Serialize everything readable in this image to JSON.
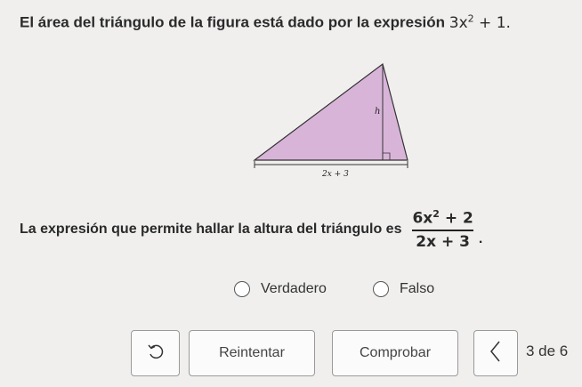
{
  "question": {
    "text": "El área del triángulo de la figura está dado por la expresión",
    "expr_base": "3x",
    "expr_exp": "2",
    "expr_tail": " + 1."
  },
  "figure": {
    "height_label": "h",
    "base_label": "2x + 3",
    "fill_color": "#d9b4d9",
    "stroke_color": "#333333"
  },
  "statement": {
    "text": "La expresión que permite hallar la altura del triángulo es",
    "num_base": "6x",
    "num_exp": "2",
    "num_tail": " + 2",
    "denominator": "2x + 3",
    "period": "."
  },
  "options": [
    {
      "label": "Verdadero",
      "selected": false
    },
    {
      "label": "Falso",
      "selected": false
    }
  ],
  "actions": {
    "retry_label": "Reintentar",
    "check_label": "Comprobar",
    "reset_icon": "undo-icon",
    "prev_icon": "chevron-left-icon"
  },
  "pager": {
    "text": "3 de 6"
  }
}
